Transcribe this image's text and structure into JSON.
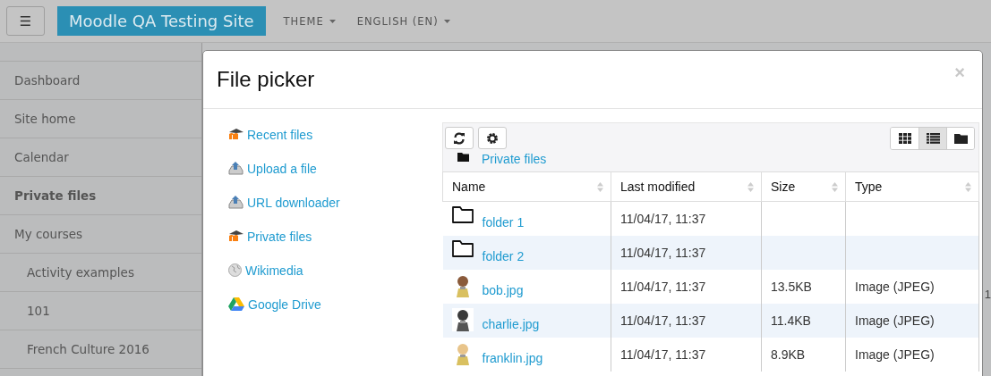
{
  "header": {
    "menu_button": "☰",
    "site_name": "Moodle QA Testing Site",
    "menus": [
      "THEME",
      "ENGLISH (EN)"
    ]
  },
  "sidebar": {
    "items": [
      {
        "label": "Dashboard",
        "selected": false
      },
      {
        "label": "Site home",
        "selected": false
      },
      {
        "label": "Calendar",
        "selected": false
      },
      {
        "label": "Private files",
        "selected": true
      },
      {
        "label": "My courses",
        "selected": false,
        "children": [
          {
            "label": "Activity examples",
            "selected": false
          },
          {
            "label": "101",
            "selected": false
          },
          {
            "label": "French Culture 2016",
            "selected": false
          }
        ]
      }
    ]
  },
  "page_edge_text": "1",
  "dialog": {
    "title": "File picker",
    "close": "×",
    "repositories": [
      {
        "label": "Recent files"
      },
      {
        "label": "Upload a file"
      },
      {
        "label": "URL downloader"
      },
      {
        "label": "Private files"
      },
      {
        "label": "Wikimedia"
      },
      {
        "label": "Google Drive"
      }
    ],
    "views": [
      {
        "selected": false
      },
      {
        "selected": true
      },
      {
        "selected": false
      }
    ],
    "path": "Private files",
    "columns": [
      "Name",
      "Last modified",
      "Size",
      "Type"
    ],
    "rows": [
      {
        "kind": "folder",
        "name": "folder 1",
        "modified": "11/04/17, 11:37"
      },
      {
        "kind": "folder",
        "name": "folder 2",
        "modified": "11/04/17, 11:37"
      },
      {
        "kind": "picture",
        "name": "bob.jpg",
        "modified": "11/04/17, 11:37",
        "size": "13.5KB",
        "type": "Image (JPEG)"
      },
      {
        "kind": "picture",
        "name": "charlie.jpg",
        "modified": "11/04/17, 11:37",
        "size": "11.4KB",
        "type": "Image (JPEG)"
      },
      {
        "kind": "picture",
        "name": "franklin.jpg",
        "modified": "11/04/17, 11:37",
        "size": "8.9KB",
        "type": "Image (JPEG)"
      }
    ]
  }
}
